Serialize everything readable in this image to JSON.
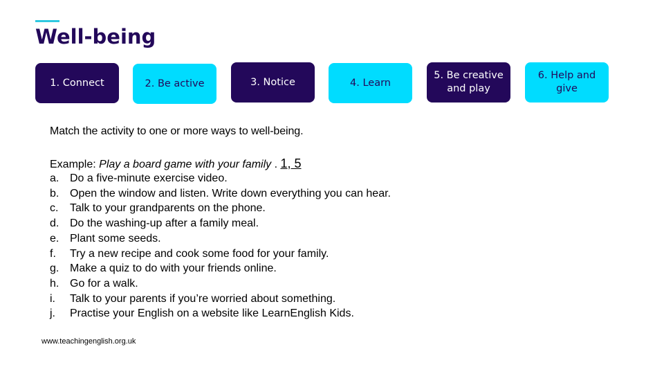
{
  "header": {
    "title": "Well-being"
  },
  "colors": {
    "accent": "#2ec8e0",
    "dark_box": "#23085a",
    "light_box": "#00dcff"
  },
  "ways": [
    {
      "label": "1. Connect",
      "style": "dark"
    },
    {
      "label": "2. Be active",
      "style": "light"
    },
    {
      "label": "3. Notice",
      "style": "dark"
    },
    {
      "label": "4. Learn",
      "style": "light"
    },
    {
      "label": "5. Be creative and play",
      "style": "dark"
    },
    {
      "label": "6. Help and give",
      "style": "light"
    }
  ],
  "exercise": {
    "instruction": "Match the activity to one or more ways to well-being.",
    "example_prefix": "Example: ",
    "example_activity": "Play a board game with your family",
    "example_separator": " . ",
    "example_answer": "1, 5",
    "items": [
      {
        "letter": "a.",
        "text": "Do a five-minute exercise video."
      },
      {
        "letter": "b.",
        "text": "Open the window and listen. Write down everything you can hear."
      },
      {
        "letter": "c.",
        "text": "Talk to your grandparents on the phone."
      },
      {
        "letter": "d.",
        "text": "Do the washing-up after a family meal."
      },
      {
        "letter": "e.",
        "text": "Plant some seeds."
      },
      {
        "letter": "f.",
        "text": "Try a new recipe and cook some food for your family."
      },
      {
        "letter": "g.",
        "text": "Make a quiz to do with your friends online."
      },
      {
        "letter": "h.",
        "text": "Go for a walk."
      },
      {
        "letter": "i.",
        "text": "Talk to your parents if you’re worried about something."
      },
      {
        "letter": "j.",
        "text": "Practise your English on a website like LearnEnglish Kids."
      }
    ]
  },
  "footer": {
    "url": "www.teachingenglish.org.uk"
  }
}
